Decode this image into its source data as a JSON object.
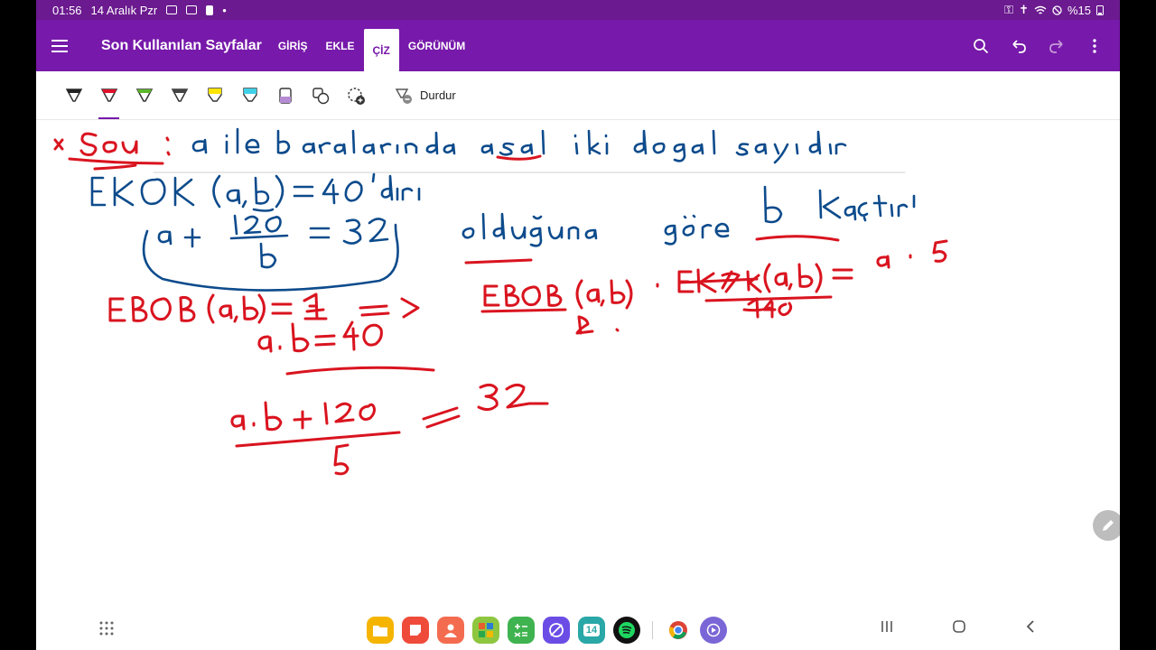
{
  "status": {
    "time": "01:56",
    "date": "14 Aralık Pzr",
    "battery": "%15"
  },
  "app": {
    "title": "Son Kullanılan Sayfalar",
    "tabs": [
      {
        "label": "GİRİŞ"
      },
      {
        "label": "EKLE"
      },
      {
        "label": "ÇİZ"
      },
      {
        "label": "GÖRÜNÜM"
      }
    ],
    "active_tab": "ÇİZ"
  },
  "toolbar": {
    "pens": [
      "#222222",
      "#e0112b",
      "#5cb82a",
      "#444444",
      "#ffe400",
      "#3fd0e6"
    ],
    "selected_pen": 1,
    "stop_label": "Durdur"
  },
  "colors": {
    "accent": "#7719aa",
    "ink_blue": "#0d4b8c",
    "ink_red": "#d9141f"
  },
  "dock": [
    {
      "icon": "my-files-icon",
      "color": "#f5b400"
    },
    {
      "icon": "samsung-notes-icon",
      "color": "#ef4b3b"
    },
    {
      "icon": "contacts-icon",
      "color": "#f46c4f"
    },
    {
      "icon": "office-icon",
      "color": "#8ec63f"
    },
    {
      "icon": "calculator-icon",
      "color": "#3fb34f"
    },
    {
      "icon": "internet-icon",
      "color": "#6b4de6"
    },
    {
      "icon": "calendar-icon",
      "color": "#2aa7a7",
      "text": "14"
    },
    {
      "icon": "spotify-icon",
      "color": "#111111"
    },
    {
      "icon": "chrome-icon",
      "color": "#ffffff"
    },
    {
      "icon": "screen-recorder-icon",
      "color": "#7a66d6"
    }
  ]
}
